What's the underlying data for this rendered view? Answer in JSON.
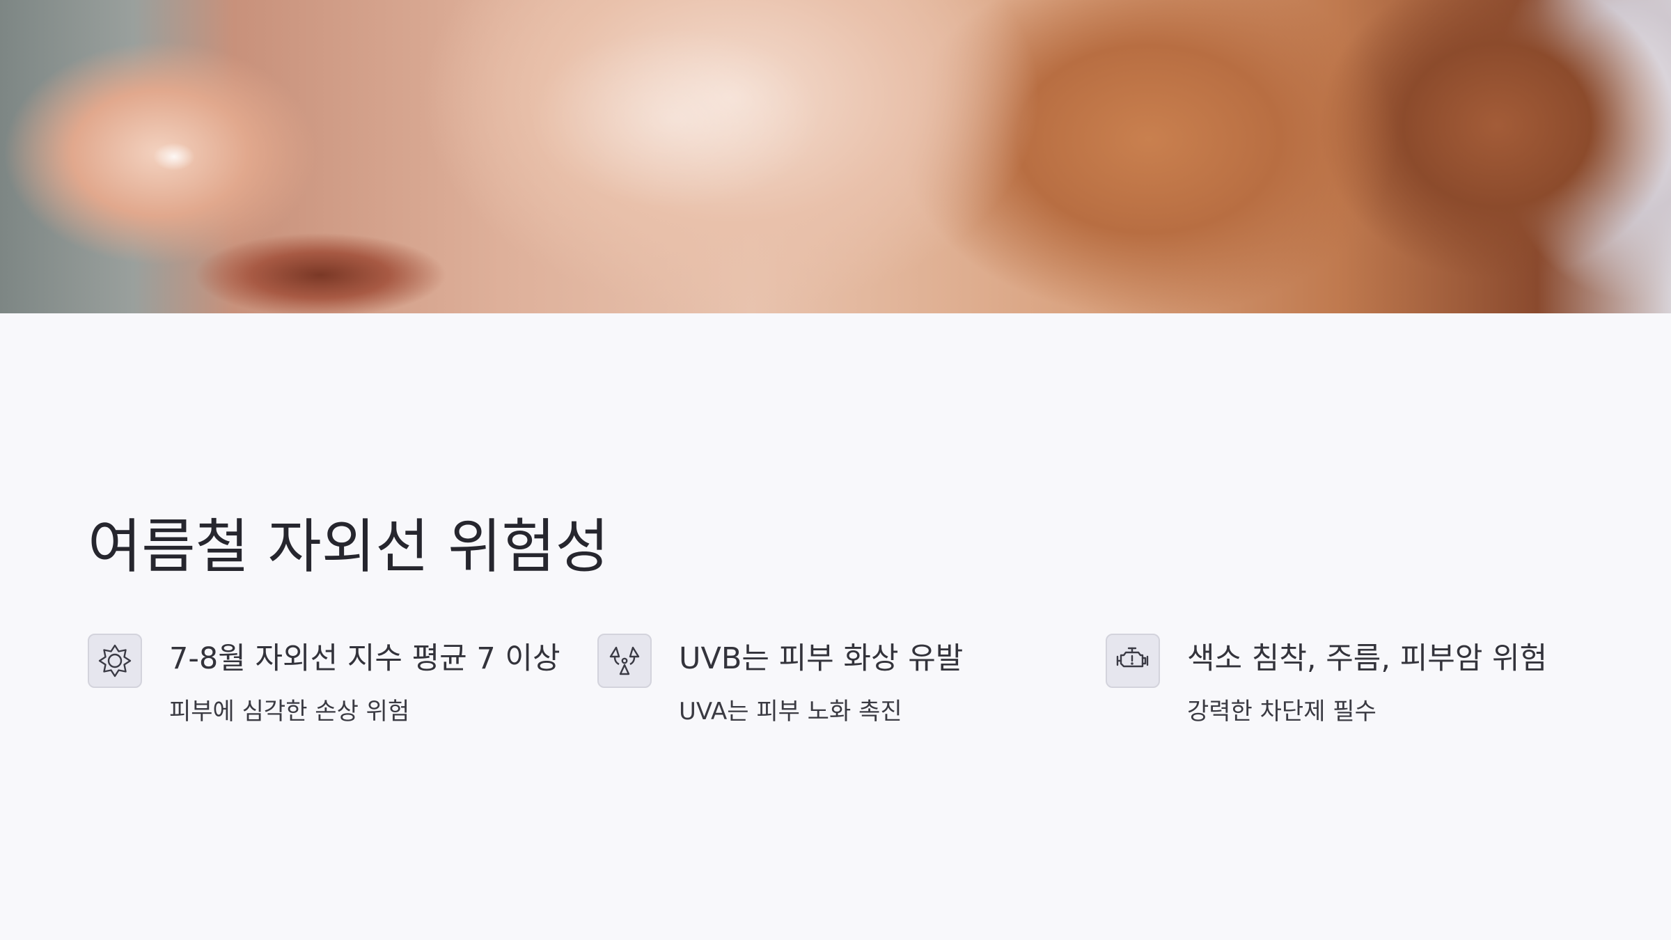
{
  "slide": {
    "title": "여름철 자외선 위험성",
    "items": [
      {
        "heading": "7-8월 자외선 지수 평균 7 이상",
        "description": "피부에 심각한 손상 위험",
        "icon": "sun-icon"
      },
      {
        "heading": "UVB는 피부 화상 유발",
        "description": "UVA는 피부 노화 촉진",
        "icon": "radiation-icon"
      },
      {
        "heading": "색소 침착, 주름, 피부암 위험",
        "description": "강력한 차단제 필수",
        "icon": "engine-warning-icon"
      }
    ]
  },
  "colors": {
    "background": "#f8f8fb",
    "text": "#26262e",
    "icon_box": "#e6e6ee",
    "icon_stroke": "#3a3a44"
  }
}
